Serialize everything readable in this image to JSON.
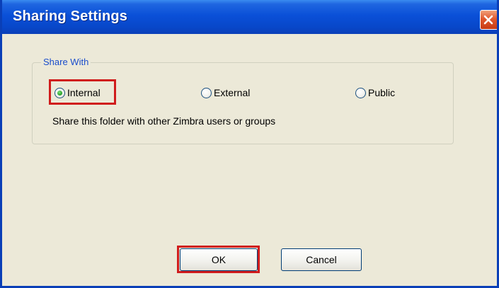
{
  "dialog": {
    "title": "Sharing Settings",
    "close_icon": "close-icon",
    "accent_color": "#0a50d8",
    "close_color": "#e0582e"
  },
  "share_with": {
    "legend": "Share With",
    "options": [
      {
        "label": "Internal",
        "selected": true
      },
      {
        "label": "External",
        "selected": false
      },
      {
        "label": "Public",
        "selected": false
      }
    ],
    "description": "Share this folder with other Zimbra users or groups"
  },
  "buttons": {
    "ok_label": "OK",
    "cancel_label": "Cancel"
  },
  "highlight_color": "#d01c1c"
}
